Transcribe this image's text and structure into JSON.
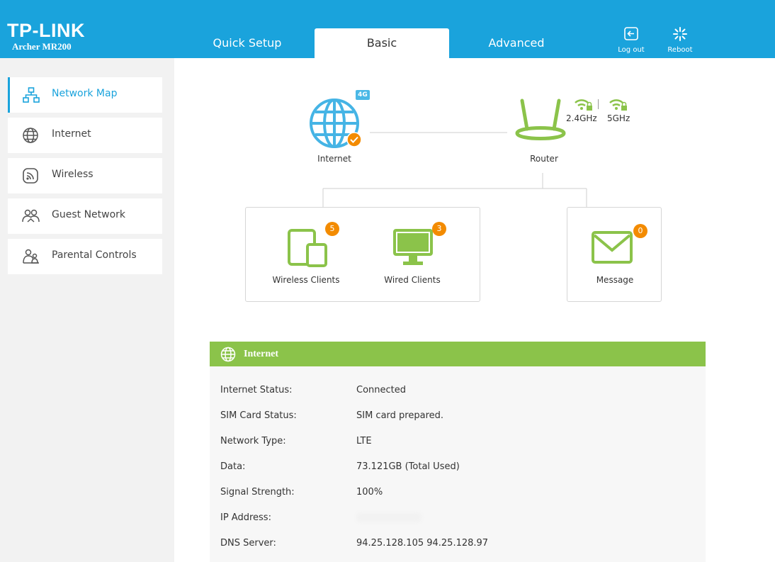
{
  "brand": {
    "logo": "TP-LINK",
    "model": "Archer MR200"
  },
  "tabs": [
    {
      "label": "Quick Setup"
    },
    {
      "label": "Basic"
    },
    {
      "label": "Advanced"
    }
  ],
  "header_actions": {
    "logout": "Log out",
    "reboot": "Reboot"
  },
  "sidebar": {
    "items": [
      {
        "label": "Network Map",
        "icon": "network-map-icon"
      },
      {
        "label": "Internet",
        "icon": "globe-icon"
      },
      {
        "label": "Wireless",
        "icon": "wireless-icon"
      },
      {
        "label": "Guest Network",
        "icon": "guest-network-icon"
      },
      {
        "label": "Parental Controls",
        "icon": "parental-controls-icon"
      }
    ]
  },
  "map": {
    "internet_label": "Internet",
    "badge_4g": "4G",
    "router_label": "Router",
    "band_24": "2.4GHz",
    "band_5": "5GHz",
    "wireless_clients_label": "Wireless Clients",
    "wireless_clients_count": "5",
    "wired_clients_label": "Wired Clients",
    "wired_clients_count": "3",
    "message_label": "Message",
    "message_count": "0"
  },
  "panel": {
    "title": "Internet",
    "rows": [
      {
        "key": "Internet Status:",
        "value": "Connected"
      },
      {
        "key": "SIM Card Status:",
        "value": "SIM card prepared."
      },
      {
        "key": "Network Type:",
        "value": "LTE"
      },
      {
        "key": "Data:",
        "value": "73.121GB (Total Used)"
      },
      {
        "key": "Signal Strength:",
        "value": "100%"
      },
      {
        "key": "IP Address:",
        "value": ""
      },
      {
        "key": "DNS Server:",
        "value": "94.25.128.105 94.25.128.97"
      }
    ]
  },
  "colors": {
    "header": "#1aa3dc",
    "accent_green": "#8bc34a",
    "badge_orange": "#f38b00",
    "active_blue": "#1aa3dc"
  }
}
